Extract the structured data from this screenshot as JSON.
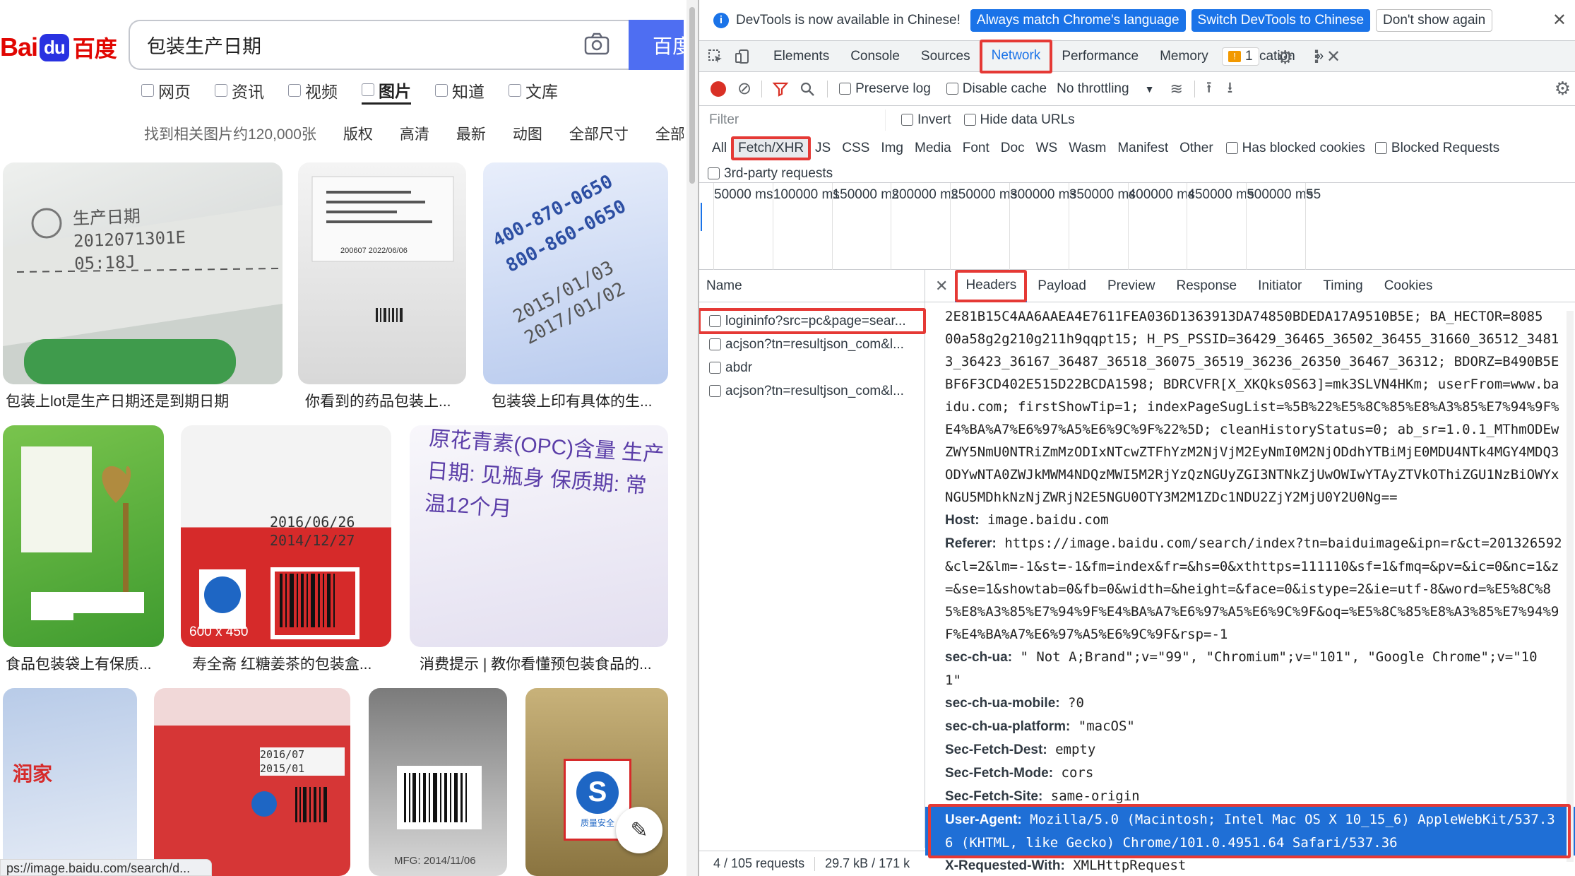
{
  "baidu": {
    "logo_latin": "Bai",
    "logo_paw": "du",
    "logo_cn": "百度",
    "query": "包装生产日期",
    "search_button": "百度",
    "nav_tabs": [
      "网页",
      "资讯",
      "视频",
      "图片",
      "知道",
      "文库"
    ],
    "active_tab": "图片",
    "result_count": "找到相关图片约120,000张",
    "filters": [
      "版权",
      "高清",
      "最新",
      "动图",
      "全部尺寸",
      "全部"
    ],
    "tiles": [
      {
        "caption": "包装上lot是生产日期还是到期日期",
        "text": "生产日期 2012071301E 05:18J"
      },
      {
        "caption": "你看到的药品包装上...",
        "text": "200607 2022/06/06"
      },
      {
        "caption": "包装袋上印有具体的生...",
        "text": "2015/01/03 2017/01/02"
      },
      {
        "caption": "食品包装袋上有保质...",
        "text": ""
      },
      {
        "caption": "寿全斋 红糖姜茶的包装盒...",
        "text": "2016/06/26 2014/12/27",
        "badge": "600 x 450"
      },
      {
        "caption": "消费提示 | 教你看懂预包装食品的...",
        "text": "原花青素(OPC)含量 生产日期: 见瓶身 保质期: 常温12个月"
      },
      {
        "caption": "",
        "text": ""
      },
      {
        "caption": "",
        "text": "2016/07 2015/01"
      },
      {
        "caption": "",
        "text": "MFG: 2014/11/06"
      },
      {
        "caption": "",
        "text": "质量安全"
      }
    ],
    "status_url": "ps://image.baidu.com/search/d..."
  },
  "devtools": {
    "info_message": "DevTools is now available in Chinese!",
    "info_btn1": "Always match Chrome's language",
    "info_btn2": "Switch DevTools to Chinese",
    "info_btn3": "Don't show again",
    "tabs": [
      "Elements",
      "Console",
      "Sources",
      "Network",
      "Performance",
      "Memory",
      "Application"
    ],
    "active_tab": "Network",
    "issues_count": "1",
    "preserve_log": "Preserve log",
    "disable_cache": "Disable cache",
    "throttling": "No throttling",
    "filter_placeholder": "Filter",
    "invert": "Invert",
    "hide_data_urls": "Hide data URLs",
    "types": [
      "All",
      "Fetch/XHR",
      "JS",
      "CSS",
      "Img",
      "Media",
      "Font",
      "Doc",
      "WS",
      "Wasm",
      "Manifest",
      "Other"
    ],
    "active_type": "Fetch/XHR",
    "has_blocked_cookies": "Has blocked cookies",
    "blocked_requests": "Blocked Requests",
    "third_party": "3rd-party requests",
    "ticks": [
      "50000 ms",
      "100000 ms",
      "150000 ms",
      "200000 ms",
      "250000 ms",
      "300000 ms",
      "350000 ms",
      "400000 ms",
      "450000 ms",
      "500000 ms",
      "55"
    ],
    "name_header": "Name",
    "requests": [
      "logininfo?src=pc&page=sear...",
      "acjson?tn=resultjson_com&l...",
      "abdr",
      "acjson?tn=resultjson_com&l..."
    ],
    "status_requests": "4 / 105 requests",
    "status_size": "29.7 kB / 171 k",
    "subtabs": [
      "Headers",
      "Payload",
      "Preview",
      "Response",
      "Initiator",
      "Timing",
      "Cookies"
    ],
    "active_subtab": "Headers",
    "cookie_lines": [
      "2E81B15C4AA6AAEA4E7611FEA036D1363913DA74850BDEDA17A9510B5E; BA_HECTOR=8085",
      "00a58g2g210g211h9qqpt15; H_PS_PSSID=36429_36465_36502_36455_31660_36512_3481",
      "3_36423_36167_36487_36518_36075_36519_36236_26350_36467_36312; BDORZ=B490B5E",
      "BF6F3CD402E515D22BCDA1598; BDRCVFR[X_XKQks0S63]=mk3SLVN4HKm; userFrom=www.ba",
      "idu.com; firstShowTip=1; indexPageSugList=%5B%22%E5%8C%85%E8%A3%85%E7%94%9F%",
      "E4%BA%A7%E6%97%A5%E6%9C%9F%22%5D; cleanHistoryStatus=0; ab_sr=1.0.1_MThmODEw",
      "ZWY5NmU0NTRiZmMzODIxNTcwZTFhYzM2NjVjM2EyNmI0M2NjODdhYTBiMjE0MDU4NTk4MGY4MDQ3",
      "ODYwNTA0ZWJkMWM4NDQzMWI5M2RjYzQzNGUyZGI3NTNkZjUwOWIwYTAyZTVkOThiZGU1NzBiOWYx",
      "NGU5MDhkNzNjZWRjN2E5NGU0OTY3M2M1ZDc1NDU2ZjY2MjU0Y2U0Ng=="
    ],
    "headers": [
      {
        "key": "Host:",
        "lines": [
          " image.baidu.com"
        ]
      },
      {
        "key": "Referer:",
        "lines": [
          " https://image.baidu.com/search/index?tn=baiduimage&ipn=r&ct=201326592",
          "&cl=2&lm=-1&st=-1&fm=index&fr=&hs=0&xthttps=111110&sf=1&fmq=&pv=&ic=0&nc=1&z",
          "=&se=1&showtab=0&fb=0&width=&height=&face=0&istype=2&ie=utf-8&word=%E5%8C%8",
          "5%E8%A3%85%E7%94%9F%E4%BA%A7%E6%97%A5%E6%9C%9F&oq=%E5%8C%85%E8%A3%85%E7%94%9",
          "F%E4%BA%A7%E6%97%A5%E6%9C%9F&rsp=-1"
        ]
      },
      {
        "key": "sec-ch-ua:",
        "lines": [
          " \" Not A;Brand\";v=\"99\", \"Chromium\";v=\"101\", \"Google Chrome\";v=\"10",
          "1\""
        ]
      },
      {
        "key": "sec-ch-ua-mobile:",
        "lines": [
          " ?0"
        ]
      },
      {
        "key": "sec-ch-ua-platform:",
        "lines": [
          " \"macOS\""
        ]
      },
      {
        "key": "Sec-Fetch-Dest:",
        "lines": [
          " empty"
        ]
      },
      {
        "key": "Sec-Fetch-Mode:",
        "lines": [
          " cors"
        ]
      },
      {
        "key": "Sec-Fetch-Site:",
        "lines": [
          " same-origin"
        ]
      }
    ],
    "user_agent_key": "User-Agent:",
    "user_agent_lines": [
      " Mozilla/5.0 (Macintosh; Intel Mac OS X 10_15_6) AppleWebKit/537.3",
      "6 (KHTML, like Gecko) Chrome/101.0.4951.64 Safari/537.36"
    ],
    "last_key": "X-Requested-With:",
    "last_value": " XMLHttpRequest",
    "accent": "#1a73e8",
    "highlight_color": "#e53935"
  }
}
